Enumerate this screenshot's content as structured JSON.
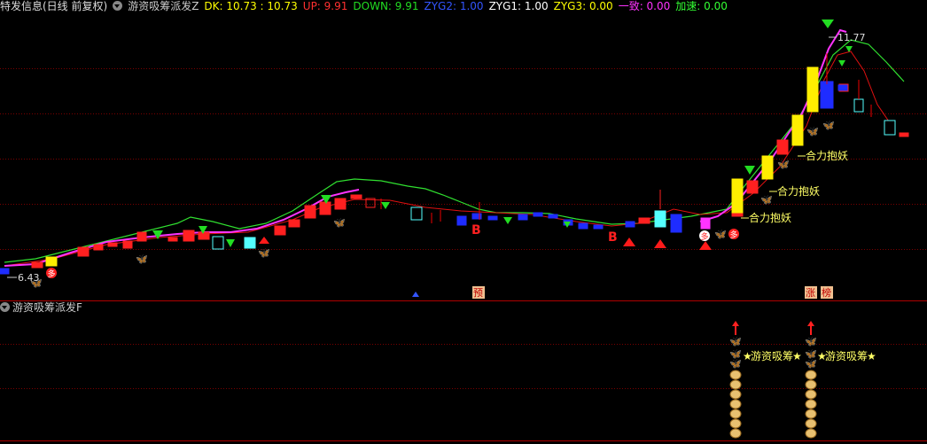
{
  "header": {
    "title": "特发信息(日线 前复权)",
    "indicator_name": "游资吸筹派发Z",
    "dk": "DK: 10.73 : 10.73",
    "up": "UP: 9.91",
    "down": "DOWN: 9.91",
    "zyg2": "ZYG2: 1.00",
    "zyg1": "ZYG1: 1.00",
    "zyg3": "ZYG3: 0.00",
    "yizhi": "一致: 0.00",
    "jiasu": "加速: 0.00"
  },
  "sub_header": {
    "indicator_name": "游资吸筹派发F"
  },
  "annotations": {
    "high_price": "11.77",
    "low_price": "6.43",
    "label_1": "合力抱妖",
    "label_2": "合力抱妖",
    "label_3": "合力抱妖",
    "sub_label_1": "游资吸筹",
    "sub_label_2": "游资吸筹",
    "b_marker_1": "B",
    "b_marker_2": "B",
    "yu_marker": "预",
    "zhang_marker": "涨",
    "bang_marker": "榜",
    "duo_marker": "多",
    "duo2": "多",
    "duo3": "多"
  },
  "colors": {
    "background": "#000000",
    "up_candle": "#ff2020",
    "down_candle_cyan": "#54ffff",
    "down_candle_blue": "#1e2cff",
    "pink_line": "#ff33ff",
    "green_line": "#30e030",
    "red_line": "#e01010",
    "yellow": "#ffee00",
    "grid": "#7a0000"
  }
}
